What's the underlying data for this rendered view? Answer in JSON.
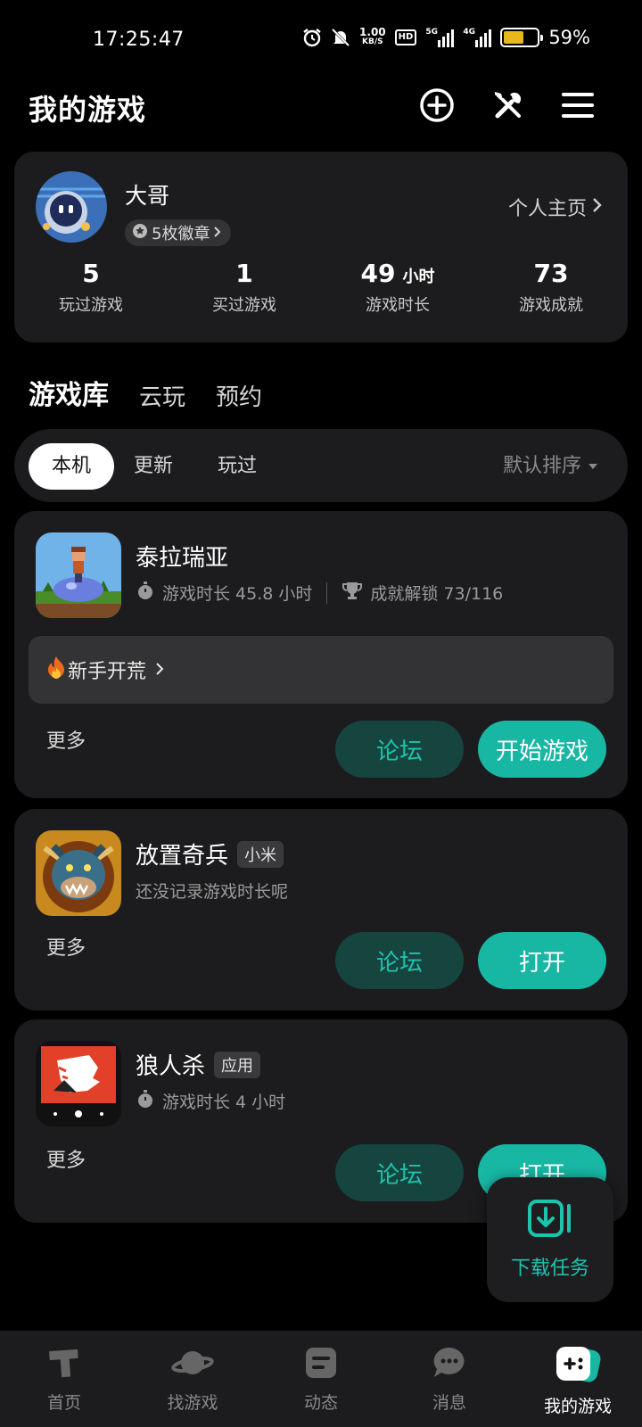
{
  "status_bar": {
    "time": "17:25:47",
    "speed_value": "1.00",
    "speed_unit": "KB/S",
    "hd": "HD",
    "signal1": "5G",
    "signal2": "4G",
    "battery_level": 0.59,
    "battery_pct": "59%",
    "battery_color": "#e8b81a"
  },
  "header": {
    "title": "我的游戏",
    "icons": [
      "add-circle-icon",
      "tools-icon",
      "menu-icon"
    ]
  },
  "profile": {
    "name": "大哥",
    "badges": "5枚徽章",
    "homepage": "个人主页",
    "stats": [
      {
        "value": "5",
        "unit": "",
        "label": "玩过游戏"
      },
      {
        "value": "1",
        "unit": "",
        "label": "买过游戏"
      },
      {
        "value": "49",
        "unit": "小时",
        "label": "游戏时长"
      },
      {
        "value": "73",
        "unit": "",
        "label": "游戏成就"
      }
    ]
  },
  "main_tabs": [
    "游戏库",
    "云玩",
    "预约"
  ],
  "sub_tabs": [
    "本机",
    "更新",
    "玩过"
  ],
  "sort_label": "默认排序",
  "games": [
    {
      "name": "泰拉瑞亚",
      "tag": "",
      "playtime": "游戏时长 45.8 小时",
      "achievements": "成就解锁 73/116",
      "strategy": "新手开荒",
      "more": "更多",
      "forum": "论坛",
      "action": "开始游戏"
    },
    {
      "name": "放置奇兵",
      "tag": "小米",
      "playtime": "还没记录游戏时长呢",
      "more": "更多",
      "forum": "论坛",
      "action": "打开"
    },
    {
      "name": "狼人杀",
      "tag": "应用",
      "playtime": "游戏时长 4 小时",
      "more": "更多",
      "forum": "论坛",
      "action": "打开"
    }
  ],
  "download": {
    "label": "下载任务"
  },
  "bottom_nav": [
    {
      "label": "首页",
      "icon": "home-icon"
    },
    {
      "label": "找游戏",
      "icon": "planet-icon"
    },
    {
      "label": "动态",
      "icon": "feed-icon"
    },
    {
      "label": "消息",
      "icon": "message-icon"
    },
    {
      "label": "我的游戏",
      "icon": "gamepad-icon",
      "active": true
    }
  ],
  "colors": {
    "accent": "#18b7a4",
    "forum_bg": "#16443e",
    "card_bg": "#1c1c1e"
  }
}
